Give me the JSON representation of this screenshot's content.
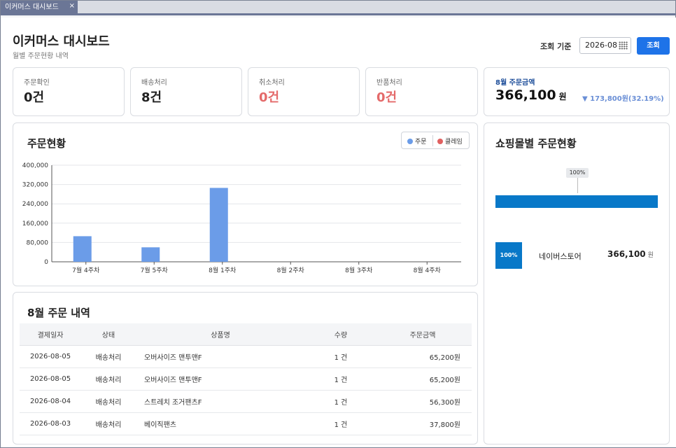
{
  "tab": {
    "label": "이커머스 대시보드",
    "close": "×"
  },
  "header": {
    "title": "이커머스 대시보드",
    "subtitle": "월별 주문현황 내역",
    "filter_label": "조회 기준",
    "date_value": "2026-08",
    "query_label": "조회"
  },
  "stats": [
    {
      "label": "주문확인",
      "value": "0건"
    },
    {
      "label": "배송처리",
      "value": "8건"
    },
    {
      "label": "취소처리",
      "value": "0건"
    },
    {
      "label": "반품처리",
      "value": "0건"
    }
  ],
  "amount": {
    "label": "8월 주문금액",
    "value": "366,100",
    "unit": "원",
    "delta": "▼ 173,800원(32.19%)"
  },
  "order_chart": {
    "title": "주문현황",
    "legend": [
      {
        "name": "주문",
        "color": "#6b9ce8"
      },
      {
        "name": "클레임",
        "color": "#e06060"
      }
    ]
  },
  "chart_data": {
    "type": "bar",
    "categories": [
      "7월 4주차",
      "7월 5주차",
      "8월 1주차",
      "8월 2주차",
      "8월 3주차",
      "8월 4주차"
    ],
    "series": [
      {
        "name": "주문",
        "values": [
          106000,
          60000,
          306000,
          0,
          0,
          0
        ]
      },
      {
        "name": "클레임",
        "values": [
          0,
          0,
          0,
          0,
          0,
          0
        ]
      }
    ],
    "yticks": [
      "0",
      "80,000",
      "160,000",
      "240,000",
      "320,000",
      "400,000"
    ],
    "ylim": [
      0,
      400000
    ],
    "grid": true
  },
  "orders": {
    "title": "8월 주문 내역",
    "columns": [
      "결제일자",
      "상태",
      "상품명",
      "수량",
      "주문금액"
    ],
    "rows": [
      [
        "2026-08-05",
        "배송처리",
        "오버사이즈 맨투맨F",
        "1 건",
        "65,200원"
      ],
      [
        "2026-08-05",
        "배송처리",
        "오버사이즈 맨투맨F",
        "1 건",
        "65,200원"
      ],
      [
        "2026-08-04",
        "배송처리",
        "스트레치 조거팬츠F",
        "1 건",
        "56,300원"
      ],
      [
        "2026-08-03",
        "배송처리",
        "베이직팬츠",
        "1 건",
        "37,800원"
      ]
    ]
  },
  "mall": {
    "title": "쇼핑몰별 주문현황",
    "bar_percent": "100%",
    "bar_share": 1.0,
    "bar_color": "#0878c8",
    "items": [
      {
        "percent": "100%",
        "name": "네이버스토어",
        "amount": "366,100",
        "unit": "원"
      }
    ]
  }
}
